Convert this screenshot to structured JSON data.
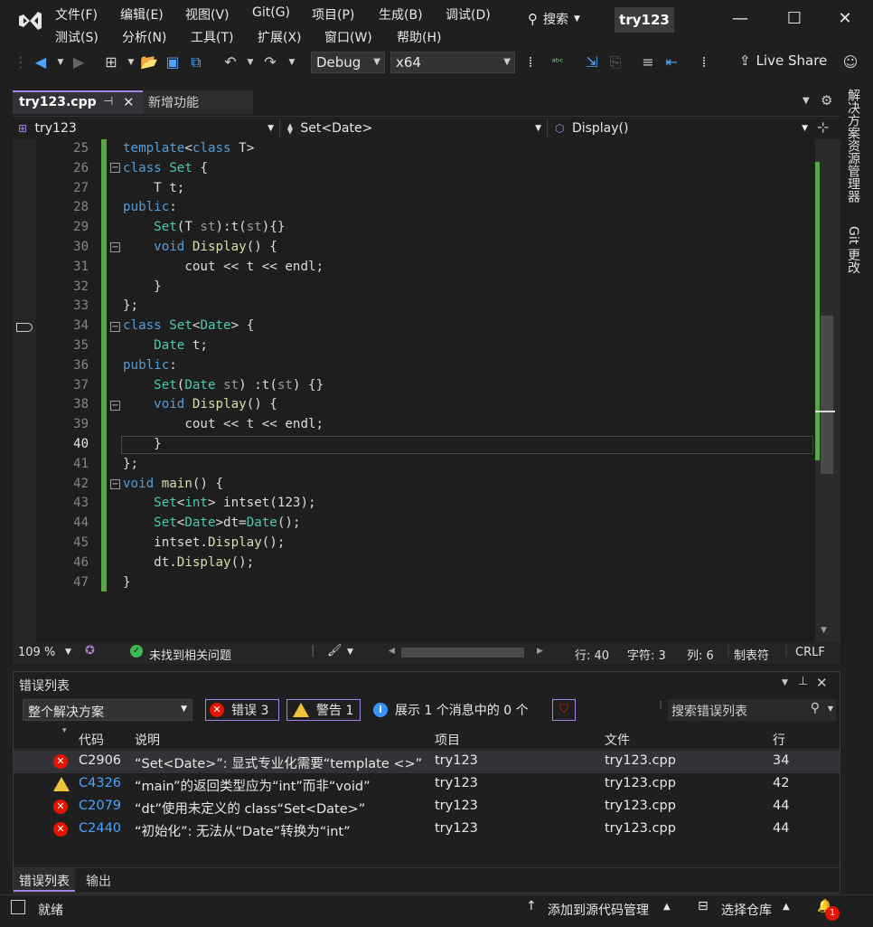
{
  "menu": {
    "row1": [
      "文件(F)",
      "编辑(E)",
      "视图(V)",
      "Git(G)",
      "项目(P)",
      "生成(B)",
      "调试(D)"
    ],
    "row2": [
      "测试(S)",
      "分析(N)",
      "工具(T)",
      "扩展(X)",
      "窗口(W)",
      "帮助(H)"
    ],
    "search_label": "搜索",
    "solution_name": "try123"
  },
  "toolbar": {
    "config": "Debug",
    "platform": "x64",
    "live_share": "Live Share"
  },
  "tabs": [
    {
      "label": "try123.cpp",
      "active": true
    },
    {
      "label": "新增功能",
      "active": false
    }
  ],
  "navbar": {
    "project": "try123",
    "scope": "Set<Date>",
    "member": "Display()"
  },
  "editor": {
    "lines": [
      {
        "n": "25",
        "text": "template<class T>"
      },
      {
        "n": "26",
        "text": "class Set {"
      },
      {
        "n": "27",
        "text": "    T t;"
      },
      {
        "n": "28",
        "text": "public:"
      },
      {
        "n": "29",
        "text": "    Set(T st):t(st){}"
      },
      {
        "n": "30",
        "text": "    void Display() {"
      },
      {
        "n": "31",
        "text": "        cout << t << endl;"
      },
      {
        "n": "32",
        "text": "    }"
      },
      {
        "n": "33",
        "text": "};"
      },
      {
        "n": "34",
        "text": "class Set<Date> {"
      },
      {
        "n": "35",
        "text": "    Date t;"
      },
      {
        "n": "36",
        "text": "public:"
      },
      {
        "n": "37",
        "text": "    Set(Date st) :t(st) {}"
      },
      {
        "n": "38",
        "text": "    void Display() {"
      },
      {
        "n": "39",
        "text": "        cout << t << endl;"
      },
      {
        "n": "40",
        "text": "    }"
      },
      {
        "n": "41",
        "text": "};"
      },
      {
        "n": "42",
        "text": "void main() {"
      },
      {
        "n": "43",
        "text": "    Set<int> intset(123);"
      },
      {
        "n": "44",
        "text": "    Set<Date>dt=Date();"
      },
      {
        "n": "45",
        "text": "    intset.Display();"
      },
      {
        "n": "46",
        "text": "    dt.Display();"
      },
      {
        "n": "47",
        "text": "}"
      }
    ],
    "current_line": "40"
  },
  "editor_status": {
    "zoom": "109 %",
    "issues": "未找到相关问题",
    "line": "行: 40",
    "char": "字符: 3",
    "col": "列: 6",
    "tabs": "制表符",
    "eol": "CRLF"
  },
  "error_list": {
    "title": "错误列表",
    "scope": "整个解决方案",
    "errors_label": "错误 3",
    "warnings_label": "警告 1",
    "messages_label": "展示 1 个消息中的 0 个",
    "search_placeholder": "搜索错误列表",
    "columns": [
      "代码",
      "说明",
      "项目",
      "文件",
      "行"
    ],
    "rows": [
      {
        "kind": "error",
        "code": "C2906",
        "desc": "“Set<Date>”: 显式专业化需要“template <>”",
        "project": "try123",
        "file": "try123.cpp",
        "line": "34"
      },
      {
        "kind": "warning",
        "code": "C4326",
        "desc": "“main”的返回类型应为“int”而非“void”",
        "project": "try123",
        "file": "try123.cpp",
        "line": "42"
      },
      {
        "kind": "error",
        "code": "C2079",
        "desc": "“dt”使用未定义的 class“Set<Date>”",
        "project": "try123",
        "file": "try123.cpp",
        "line": "44"
      },
      {
        "kind": "error",
        "code": "C2440",
        "desc": "“初始化”: 无法从“Date”转换为“int”",
        "project": "try123",
        "file": "try123.cpp",
        "line": "44"
      }
    ],
    "bottom_tabs": [
      "错误列表",
      "输出"
    ]
  },
  "statusbar": {
    "ready": "就绪",
    "add_source": "添加到源代码管理",
    "select_repo": "选择仓库",
    "notifications": "1"
  },
  "rightdock": {
    "solution_explorer": "解决方案资源管理器",
    "git_changes": "Git 更改"
  },
  "colors": {
    "accent": "#a484e8",
    "change_bar": "#57a64a",
    "error": "#e51400",
    "warning": "#f0c33c",
    "keyword": "#569cd6",
    "type": "#4ec9b0",
    "function": "#dcdcaa"
  }
}
